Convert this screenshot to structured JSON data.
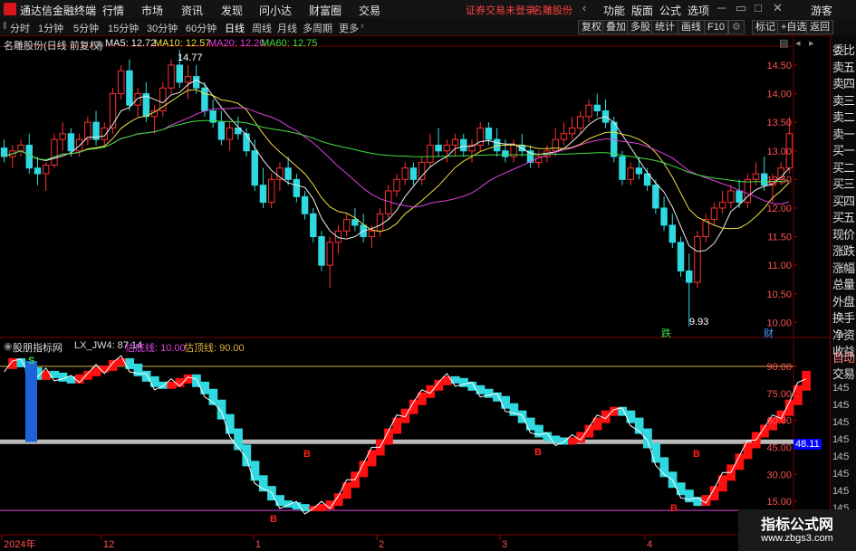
{
  "app": {
    "title": "通达信金融终端"
  },
  "menu": {
    "items": [
      "行情",
      "市场",
      "资讯",
      "发现",
      "问小达",
      "财富圈",
      "交易"
    ]
  },
  "top_right": {
    "warning": "证券交易未登录",
    "stock": "名雕股份",
    "items": [
      "功能",
      "版面",
      "公式",
      "选项"
    ],
    "guest": "游客"
  },
  "toolbar": {
    "periods": [
      "分时",
      "1分钟",
      "5分钟",
      "15分钟",
      "30分钟",
      "60分钟",
      "日线",
      "周线",
      "月线",
      "多周期",
      "更多"
    ],
    "active_period": "日线",
    "right_buttons": [
      "复权",
      "叠加",
      "多股",
      "统计",
      "画线",
      "F10",
      "标记",
      "+自选",
      "返回"
    ]
  },
  "price_panel": {
    "stock_label": "名雕股份(日线 前复权)",
    "ma": [
      {
        "label": "MA5: 12.72",
        "color": "#f0f0f0"
      },
      {
        "label": "MA10: 12.57",
        "color": "#f0e040"
      },
      {
        "label": "MA20: 12.20",
        "color": "#e040e0"
      },
      {
        "label": "MA60: 12.75",
        "color": "#40e040"
      }
    ],
    "y_ticks": [
      "14.50",
      "14.00",
      "13.50",
      "13.00",
      "12.50",
      "12.00",
      "11.50",
      "11.00",
      "10.50",
      "10.00"
    ],
    "high_label": "14.77",
    "low_label": "9.93",
    "markers": [
      {
        "text": "跌",
        "color": "#40e040"
      },
      {
        "text": "财",
        "color": "#40a0ff"
      }
    ]
  },
  "indicator_panel": {
    "name": "股朋指标网",
    "value_label": "LX_JW4: 87.14",
    "low_line_label": "估底线: 10.00",
    "high_line_label": "估顶线: 90.00",
    "colors": {
      "name": "#dddddd",
      "value": "#dddddd",
      "low": "#e040e0",
      "high": "#e0b040"
    },
    "y_ticks": [
      "90.00",
      "75.00",
      "60.00",
      "45.00",
      "30.00",
      "15.00"
    ],
    "current_value": "48.11",
    "signals": [
      "S",
      "B",
      "B",
      "B",
      "B",
      "B"
    ]
  },
  "x_axis": {
    "labels": [
      "2024年",
      "12",
      "1",
      "2",
      "3",
      "4"
    ]
  },
  "right_panel": {
    "items": [
      "委比",
      "卖五",
      "卖四",
      "卖三",
      "卖二",
      "卖一",
      "买一",
      "买二",
      "买三",
      "买四",
      "买五",
      "现价",
      "涨跌",
      "涨幅",
      "总量",
      "外盘",
      "换手",
      "净资",
      "收益"
    ],
    "trade_items": [
      "自动",
      "交易"
    ],
    "times": [
      "14:5",
      "14:5",
      "14:5",
      "14:5",
      "14:5",
      "14:5",
      "14:5",
      "14:5",
      "14:5",
      "14:5"
    ]
  },
  "watermark": {
    "title": "指标公式网",
    "url": "www.zbgs3.com"
  },
  "chart_data": {
    "type": "candlestick",
    "price_range": [
      9.8,
      14.8
    ],
    "candles": [
      [
        13.05,
        13.2,
        12.8,
        12.9
      ],
      [
        12.9,
        13.1,
        12.7,
        13.0
      ],
      [
        13.0,
        13.2,
        12.9,
        13.1
      ],
      [
        13.1,
        13.3,
        12.6,
        12.7
      ],
      [
        12.7,
        12.9,
        12.4,
        12.6
      ],
      [
        12.6,
        12.8,
        12.3,
        12.75
      ],
      [
        12.75,
        13.3,
        12.7,
        13.2
      ],
      [
        13.2,
        13.5,
        13.0,
        13.3
      ],
      [
        13.3,
        13.4,
        12.9,
        13.0
      ],
      [
        13.0,
        13.3,
        12.9,
        13.2
      ],
      [
        13.2,
        13.6,
        13.1,
        13.5
      ],
      [
        13.5,
        13.7,
        13.1,
        13.2
      ],
      [
        13.2,
        13.5,
        13.1,
        13.4
      ],
      [
        13.4,
        14.1,
        13.3,
        14.0
      ],
      [
        14.0,
        14.5,
        13.9,
        14.4
      ],
      [
        14.4,
        14.6,
        13.7,
        13.8
      ],
      [
        13.8,
        14.1,
        13.6,
        14.0
      ],
      [
        14.0,
        14.2,
        13.5,
        13.6
      ],
      [
        13.6,
        13.8,
        13.3,
        13.7
      ],
      [
        13.7,
        14.2,
        13.6,
        14.1
      ],
      [
        14.1,
        14.6,
        14.0,
        14.5
      ],
      [
        14.5,
        14.77,
        14.1,
        14.2
      ],
      [
        14.2,
        14.5,
        13.9,
        14.3
      ],
      [
        14.3,
        14.5,
        14.0,
        14.1
      ],
      [
        14.1,
        14.2,
        13.6,
        13.7
      ],
      [
        13.7,
        13.9,
        13.4,
        13.5
      ],
      [
        13.5,
        13.7,
        13.1,
        13.2
      ],
      [
        13.2,
        13.5,
        13.0,
        13.4
      ],
      [
        13.4,
        13.6,
        13.2,
        13.3
      ],
      [
        13.3,
        13.4,
        12.9,
        13.0
      ],
      [
        13.0,
        13.2,
        12.3,
        12.4
      ],
      [
        12.4,
        12.7,
        12.0,
        12.1
      ],
      [
        12.1,
        12.6,
        12.0,
        12.5
      ],
      [
        12.5,
        12.8,
        12.3,
        12.7
      ],
      [
        12.7,
        12.9,
        12.4,
        12.5
      ],
      [
        12.5,
        12.6,
        12.1,
        12.2
      ],
      [
        12.2,
        12.3,
        11.8,
        11.9
      ],
      [
        11.9,
        12.0,
        11.4,
        11.5
      ],
      [
        11.5,
        11.6,
        10.9,
        11.0
      ],
      [
        11.0,
        11.5,
        10.6,
        11.4
      ],
      [
        11.4,
        11.7,
        11.2,
        11.6
      ],
      [
        11.6,
        11.9,
        11.5,
        11.8
      ],
      [
        11.8,
        12.0,
        11.6,
        11.7
      ],
      [
        11.7,
        11.9,
        11.4,
        11.5
      ],
      [
        11.5,
        11.7,
        11.3,
        11.6
      ],
      [
        11.6,
        12.0,
        11.5,
        11.9
      ],
      [
        11.9,
        12.4,
        11.8,
        12.3
      ],
      [
        12.3,
        12.6,
        12.2,
        12.5
      ],
      [
        12.5,
        12.8,
        12.4,
        12.7
      ],
      [
        12.7,
        12.8,
        12.4,
        12.5
      ],
      [
        12.5,
        12.9,
        12.4,
        12.8
      ],
      [
        12.8,
        13.3,
        12.7,
        13.1
      ],
      [
        13.1,
        13.4,
        12.9,
        13.0
      ],
      [
        13.0,
        13.2,
        12.8,
        13.1
      ],
      [
        13.1,
        13.3,
        12.9,
        13.2
      ],
      [
        13.2,
        13.3,
        12.9,
        13.0
      ],
      [
        13.0,
        13.2,
        12.8,
        13.1
      ],
      [
        13.1,
        13.5,
        13.0,
        13.4
      ],
      [
        13.4,
        13.5,
        13.1,
        13.2
      ],
      [
        13.2,
        13.4,
        12.9,
        13.0
      ],
      [
        13.0,
        13.2,
        12.8,
        12.9
      ],
      [
        12.9,
        13.2,
        12.8,
        13.1
      ],
      [
        13.1,
        13.3,
        12.9,
        13.0
      ],
      [
        13.0,
        13.1,
        12.7,
        12.8
      ],
      [
        12.8,
        13.0,
        12.7,
        12.9
      ],
      [
        12.9,
        13.1,
        12.8,
        13.0
      ],
      [
        13.0,
        13.4,
        12.9,
        13.2
      ],
      [
        13.2,
        13.5,
        13.1,
        13.3
      ],
      [
        13.3,
        13.6,
        13.2,
        13.4
      ],
      [
        13.4,
        13.7,
        13.3,
        13.6
      ],
      [
        13.6,
        13.9,
        13.5,
        13.8
      ],
      [
        13.8,
        14.0,
        13.6,
        13.7
      ],
      [
        13.7,
        13.9,
        13.4,
        13.5
      ],
      [
        13.5,
        13.6,
        12.8,
        12.9
      ],
      [
        12.9,
        13.0,
        12.4,
        12.5
      ],
      [
        12.5,
        12.8,
        12.4,
        12.7
      ],
      [
        12.7,
        12.9,
        12.5,
        12.6
      ],
      [
        12.6,
        12.7,
        12.3,
        12.4
      ],
      [
        12.4,
        12.5,
        11.9,
        12.0
      ],
      [
        12.0,
        12.2,
        11.6,
        11.7
      ],
      [
        11.7,
        11.9,
        11.3,
        11.4
      ],
      [
        11.4,
        11.5,
        10.8,
        10.9
      ],
      [
        10.9,
        11.2,
        9.93,
        10.7
      ],
      [
        10.7,
        11.6,
        10.6,
        11.5
      ],
      [
        11.5,
        11.9,
        11.4,
        11.8
      ],
      [
        11.8,
        12.1,
        11.7,
        12.0
      ],
      [
        12.0,
        12.3,
        11.9,
        12.1
      ],
      [
        12.1,
        12.4,
        12.0,
        12.3
      ],
      [
        12.3,
        12.5,
        12.0,
        12.1
      ],
      [
        12.1,
        12.6,
        12.0,
        12.5
      ],
      [
        12.5,
        12.8,
        12.4,
        12.6
      ],
      [
        12.6,
        12.9,
        12.3,
        12.4
      ],
      [
        12.4,
        12.6,
        12.1,
        12.5
      ],
      [
        12.5,
        12.8,
        12.4,
        12.7
      ],
      [
        12.7,
        13.6,
        12.6,
        13.3
      ]
    ],
    "ma_periods": [
      5,
      10,
      20,
      60
    ],
    "indicator": {
      "range": [
        0,
        100
      ],
      "low_line": 10,
      "high_line": 90,
      "gray_line": 48.11,
      "values": [
        90,
        93,
        91,
        88,
        84,
        86,
        85,
        83,
        82,
        84,
        86,
        88,
        89,
        92,
        93,
        90,
        86,
        83,
        80,
        79,
        80,
        82,
        84,
        80,
        76,
        70,
        62,
        54,
        45,
        36,
        28,
        22,
        17,
        14,
        13,
        12,
        11,
        11,
        12,
        14,
        18,
        24,
        30,
        36,
        42,
        48,
        54,
        60,
        65,
        70,
        74,
        78,
        81,
        83,
        82,
        80,
        78,
        76,
        74,
        72,
        68,
        64,
        60,
        56,
        52,
        50,
        49,
        48,
        49,
        52,
        56,
        60,
        64,
        66,
        64,
        60,
        54,
        46,
        38,
        30,
        24,
        20,
        16,
        14,
        17,
        22,
        28,
        34,
        40,
        46,
        52,
        56,
        60,
        64,
        70,
        78,
        86
      ]
    }
  }
}
